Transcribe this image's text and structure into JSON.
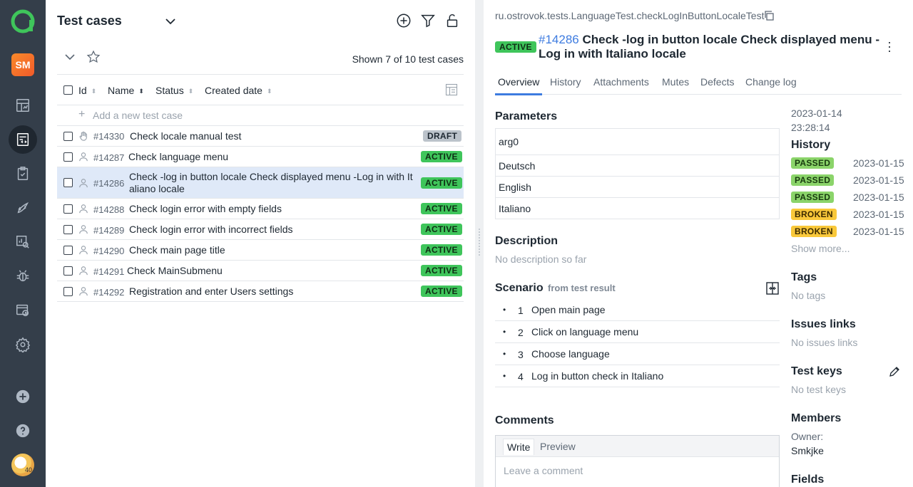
{
  "nav": {
    "project_initials": "SM",
    "avatar_text": "40",
    "items": [
      {
        "icon": "dashboard-icon"
      },
      {
        "icon": "test-cases-icon",
        "active": true
      },
      {
        "icon": "test-plans-icon"
      },
      {
        "icon": "launches-icon"
      },
      {
        "icon": "analytics-icon"
      },
      {
        "icon": "defects-icon"
      },
      {
        "icon": "jobs-icon"
      },
      {
        "icon": "settings-icon"
      }
    ]
  },
  "list": {
    "title": "Test cases",
    "shown": "Shown 7 of 10 test cases",
    "columns": {
      "id": "Id",
      "name": "Name",
      "status": "Status",
      "created": "Created date"
    },
    "add_placeholder": "Add a new test case",
    "rows": [
      {
        "id": "#14330",
        "name": "Check locale manual test",
        "status": "DRAFT",
        "type": "manual"
      },
      {
        "id": "#14287",
        "name": "Check language menu",
        "status": "ACTIVE",
        "type": "automated"
      },
      {
        "id": "#14286",
        "name": "Check -log in button locale Check displayed menu -Log in with It",
        "name2": "aliano locale",
        "status": "ACTIVE",
        "type": "automated",
        "selected": true
      },
      {
        "id": "#14288",
        "name": "Check login error with empty fields",
        "status": "ACTIVE",
        "type": "automated"
      },
      {
        "id": "#14289",
        "name": "Check login error with incorrect fields",
        "status": "ACTIVE",
        "type": "automated"
      },
      {
        "id": "#14290",
        "name": "Check main page title",
        "status": "ACTIVE",
        "type": "automated"
      },
      {
        "id": "#14291",
        "name": "Check MainSubmenu",
        "status": "ACTIVE",
        "type": "automated"
      },
      {
        "id": "#14292",
        "name": "Registration and enter Users settings",
        "status": "ACTIVE",
        "type": "automated"
      }
    ]
  },
  "detail": {
    "fqn": "ru.ostrovok.tests.LanguageTest.checkLogInButtonLocaleTest",
    "status": "ACTIVE",
    "id": "#14286",
    "title": "Check -log in button locale Check displayed menu - Log in with Italiano locale",
    "tabs": [
      "Overview",
      "History",
      "Attachments",
      "Mutes",
      "Defects",
      "Change log"
    ],
    "parameters_title": "Parameters",
    "param_name": "arg0",
    "param_values": [
      "Deutsch",
      "English",
      "Italiano"
    ],
    "description_title": "Description",
    "description_empty": "No description so far",
    "scenario_title": "Scenario",
    "scenario_source": "from test result",
    "steps": [
      "Open main page",
      "Click on language menu",
      "Choose language",
      "Log in button check in Italiano"
    ],
    "comments_title": "Comments",
    "comment_tabs": {
      "write": "Write",
      "preview": "Preview"
    },
    "comment_placeholder": "Leave a comment"
  },
  "side": {
    "created_date": "2023-01-14",
    "created_time": "23:28:14",
    "history_title": "History",
    "history": [
      {
        "status": "PASSED",
        "date": "2023-01-15"
      },
      {
        "status": "PASSED",
        "date": "2023-01-15"
      },
      {
        "status": "PASSED",
        "date": "2023-01-15"
      },
      {
        "status": "BROKEN",
        "date": "2023-01-15"
      },
      {
        "status": "BROKEN",
        "date": "2023-01-15"
      }
    ],
    "show_more": "Show more...",
    "tags_title": "Tags",
    "tags_empty": "No tags",
    "issues_title": "Issues links",
    "issues_empty": "No issues links",
    "keys_title": "Test keys",
    "keys_empty": "No test keys",
    "members_title": "Members",
    "owner_label": "Owner:",
    "owner_name": "Smkjke",
    "fields_title": "Fields"
  }
}
